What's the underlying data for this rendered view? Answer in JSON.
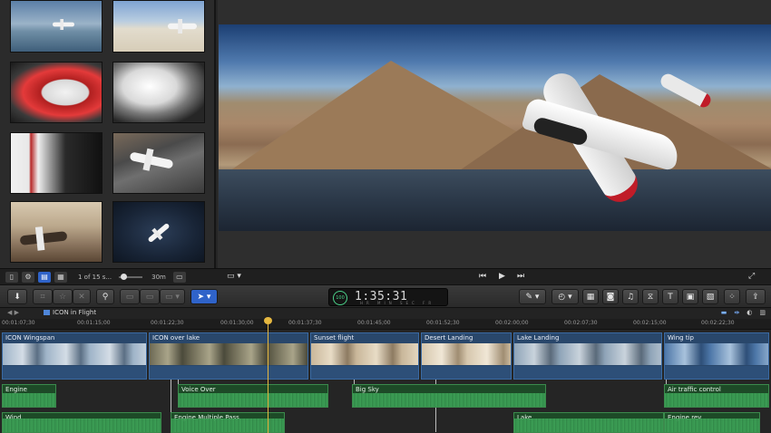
{
  "browser": {
    "clip_count": "1 of 15 s...",
    "duration": "30m"
  },
  "timecode": {
    "value": "1:35:31",
    "badge": "100",
    "labels": "HR MIN SEC FR"
  },
  "timeline": {
    "project_name": "ICON in Flight",
    "ruler_ticks": [
      "00:01:07;30",
      "00:01:15;00",
      "00:01:22;30",
      "00:01:30;00",
      "00:01:37;30",
      "00:01:45;00",
      "00:01:52;30",
      "00:02:00;00",
      "00:02:07;30",
      "00:02:15;00",
      "00:02:22;30"
    ],
    "video_clips": [
      {
        "label": "ICON Wingspan"
      },
      {
        "label": "ICON over lake"
      },
      {
        "label": "Sunset flight"
      },
      {
        "label": "Desert Landing"
      },
      {
        "label": "Lake Landing"
      },
      {
        "label": "Wing tip"
      }
    ],
    "audio_clips": [
      {
        "label": "Engine"
      },
      {
        "label": "Voice Over"
      },
      {
        "label": "Big Sky"
      },
      {
        "label": "Air traffic control"
      },
      {
        "label": "Wind"
      },
      {
        "label": "Engine Multiple Pass"
      },
      {
        "label": "Lake"
      },
      {
        "label": "Engine rev"
      }
    ]
  },
  "icons": [
    "import-icon",
    "keyword-icon",
    "favorite-icon",
    "reject-icon",
    "inspector-icon",
    "select-tool-icon",
    "magic-wand-icon",
    "retime-icon",
    "photo-icon",
    "music-icon",
    "transitions-icon",
    "titles-icon",
    "generators-icon",
    "themes-icon",
    "share-icon",
    "play-icon",
    "prev-frame-icon",
    "next-frame-icon",
    "fullscreen-icon"
  ],
  "colors": {
    "accent": "#2f63c9",
    "playhead": "#e6b840",
    "video_clip": "#29476b",
    "audio_clip": "#1d4a27"
  }
}
